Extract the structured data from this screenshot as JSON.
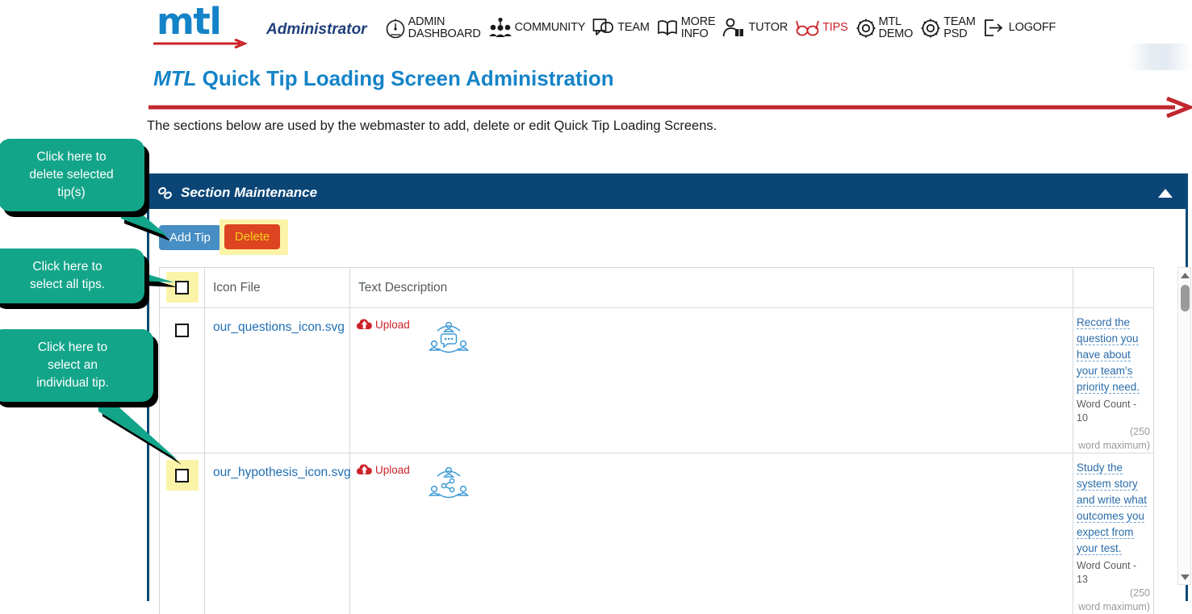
{
  "brand": {
    "logo_text": "mtl",
    "role": "Administrator"
  },
  "nav": [
    {
      "id": "admin-dashboard",
      "icon": "gauge-icon",
      "line1": "ADMIN",
      "line2": "DASHBOARD",
      "active": false
    },
    {
      "id": "community",
      "icon": "people-group-icon",
      "line1": "COMMUNITY",
      "line2": "",
      "active": false
    },
    {
      "id": "team",
      "icon": "speech-bubble-icon",
      "line1": "TEAM",
      "line2": "",
      "active": false
    },
    {
      "id": "more-info",
      "icon": "open-book-icon",
      "line1": "MORE",
      "line2": "INFO",
      "active": false
    },
    {
      "id": "tutor",
      "icon": "person-book-icon",
      "line1": "TUTOR",
      "line2": "",
      "active": false
    },
    {
      "id": "tips",
      "icon": "glasses-icon",
      "line1": "TIPS",
      "line2": "",
      "active": true
    },
    {
      "id": "mtl-demo",
      "icon": "gear-icon",
      "line1": "MTL",
      "line2": "DEMO",
      "active": false
    },
    {
      "id": "team-psd",
      "icon": "gear-icon",
      "line1": "TEAM",
      "line2": "PSD",
      "active": false
    },
    {
      "id": "logoff",
      "icon": "logout-icon",
      "line1": "LOGOFF",
      "line2": "",
      "active": false
    }
  ],
  "page": {
    "title_emphasis": "MTL",
    "title_rest": " Quick Tip Loading Screen Administration",
    "subtitle": "The sections below are used by the webmaster to add, delete or edit Quick Tip Loading Screens."
  },
  "panel": {
    "header_title": "Section Maintenance",
    "header_icon": "chain-link-icon",
    "collapse_icon": "chevron-up-icon"
  },
  "toolbar": {
    "add_label": "Add Tip",
    "delete_label": "Delete"
  },
  "table": {
    "headers": {
      "select_all": "",
      "icon_file": "Icon File",
      "text_description": "Text Description",
      "text_col": ""
    },
    "upload_label": "Upload",
    "rows": [
      {
        "file": "our_questions_icon.svg",
        "row_icon": "collaboration-chat-icon",
        "description": "Record the question you have about your team's priority need.",
        "word_count_label": "Word Count -",
        "word_count": "10",
        "max_note_line1": "(250",
        "max_note_line2": "word maximum)",
        "highlighted": false
      },
      {
        "file": "our_hypothesis_icon.svg",
        "row_icon": "network-share-icon",
        "description": "Study the system story and write what outcomes you expect from your test.",
        "word_count_label": "Word Count -",
        "word_count": "13",
        "max_note_line1": "(250",
        "max_note_line2": "word maximum)",
        "highlighted": true
      }
    ]
  },
  "scrollbar": {
    "up_icon": "triangle-up-icon",
    "down_icon": "triangle-down-icon"
  },
  "callouts": [
    {
      "id": "callout-delete",
      "line1": "Click here to",
      "line2": "delete selected",
      "line3": "tip(s)"
    },
    {
      "id": "callout-select-all",
      "line1": "Click here to",
      "line2": "select all tips.",
      "line3": ""
    },
    {
      "id": "callout-select-one",
      "line1": "Click here to",
      "line2": "select an",
      "line3": "individual tip."
    }
  ],
  "colors": {
    "brand_blue": "#1583c7",
    "panel_blue": "#0a4576",
    "accent_red": "#cc2229",
    "callout_teal": "#13a589",
    "highlight_yellow": "#fbf4a8",
    "delete_orange": "#dd4420"
  }
}
